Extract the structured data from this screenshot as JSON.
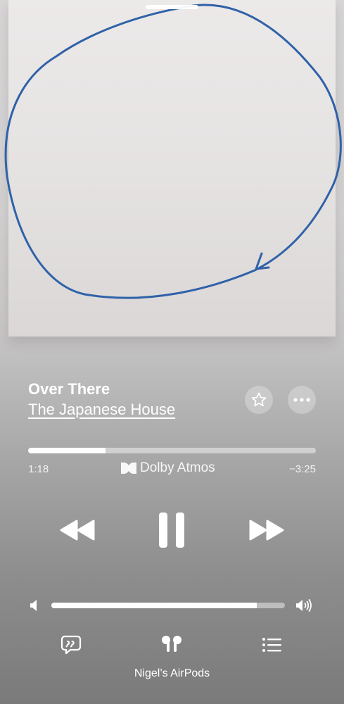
{
  "artwork": {
    "description_icon": "hand-drawn-circle-arrow",
    "stroke_color": "#2f62a8"
  },
  "now_playing": {
    "title": "Over There",
    "artist": "The Japanese House"
  },
  "actions": {
    "favorite_icon": "star-icon",
    "more_icon": "ellipsis-icon"
  },
  "playback": {
    "elapsed": "1:18",
    "remaining": "−3:25",
    "progress_fraction": 0.27,
    "audio_format": "Dolby Atmos"
  },
  "transport": {
    "rewind_icon": "rewind-icon",
    "pause_icon": "pause-icon",
    "forward_icon": "fast-forward-icon"
  },
  "volume": {
    "level_fraction": 0.88
  },
  "bottom_bar": {
    "lyrics_icon": "lyrics-icon",
    "airplay_icon": "airpods-icon",
    "queue_icon": "queue-list-icon",
    "output_device": "Nigel’s AirPods"
  }
}
